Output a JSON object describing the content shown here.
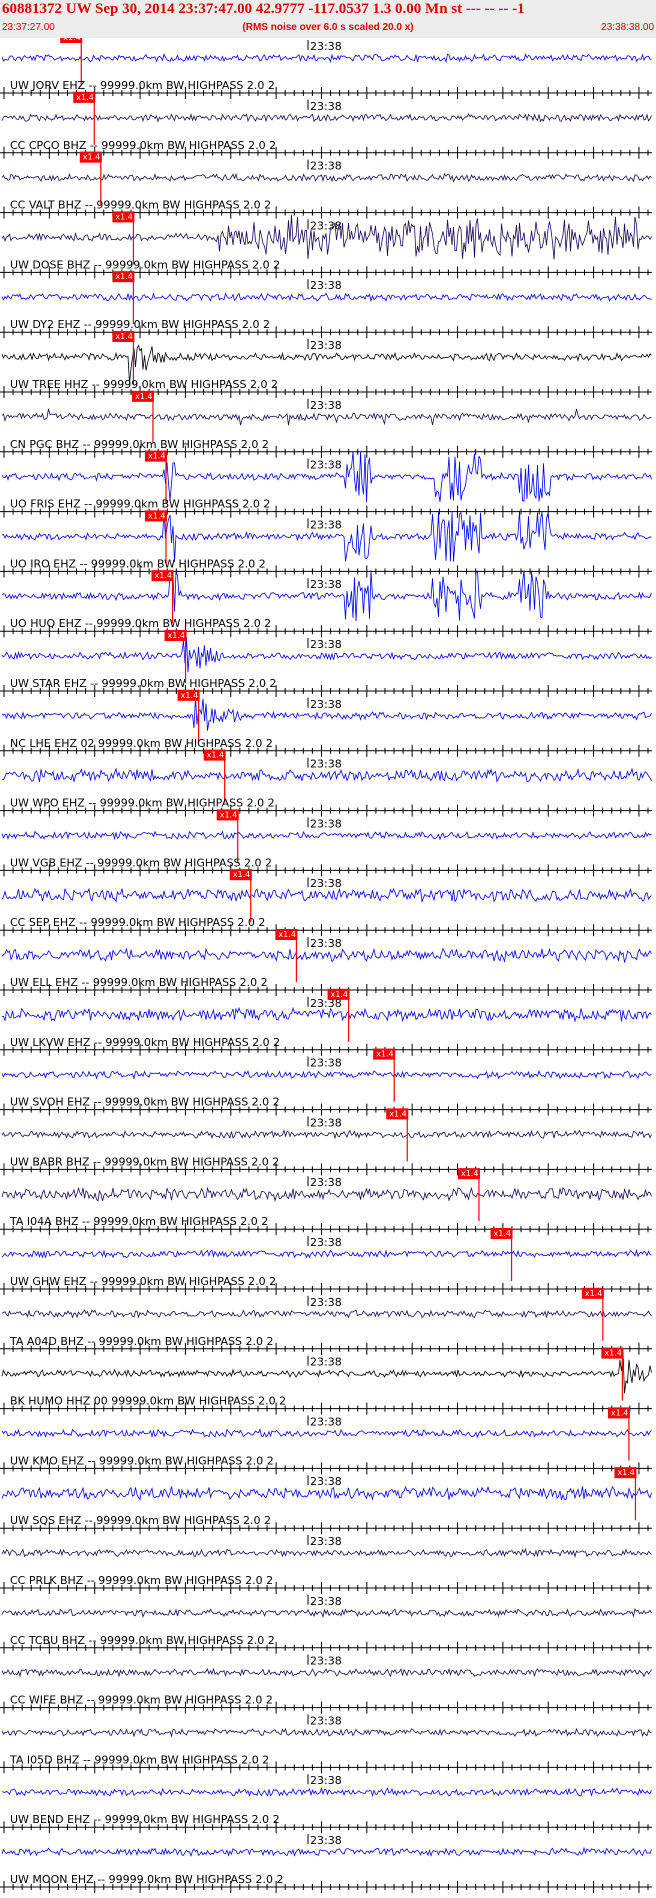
{
  "header": {
    "title": "60881372 UW Sep 30, 2014 23:37:47.00   42.9777 -117.0537  1.3 0.00 Mn st --- -- --   -1",
    "start_time": "23:37:27.00",
    "note": "(RMS noise over 6.0 s scaled 20.0 x)",
    "end_time": "23:38:38.00"
  },
  "colors": {
    "header_text": "#e00000",
    "header_bg": "#ededed",
    "pick": "#ff0000",
    "trace_blue": "#0000ff",
    "trace_navy": "#1a0a5a",
    "trace_black": "#000000"
  },
  "chart_data": {
    "type": "line",
    "title": "60881372 UW Sep 30, 2014 23:37:47.00   42.9777 -117.0537  1.3 0.00 Mn st --- -- --   -1",
    "x_range": [
      "23:37:27.00",
      "23:38:38.00"
    ],
    "time_mark": "23:38",
    "pick_label": "x1.4",
    "grid": false,
    "series": [
      {
        "label": "UW JORV EHZ -- 99999.0km BW  HIGHPASS  2.0  2",
        "color": "#0000ff",
        "pick": 0.12,
        "activity": "low"
      },
      {
        "label": "CC CPCO BHZ -- 99999.0km BW  HIGHPASS  2.0  2",
        "color": "#1a0a5a",
        "pick": 0.14,
        "activity": "low"
      },
      {
        "label": "CC VALT BHZ -- 99999.0km BW  HIGHPASS  2.0  2",
        "color": "#1a0a5a",
        "pick": 0.15,
        "activity": "low"
      },
      {
        "label": "UW DOSE BHZ -- 99999.0km BW  HIGHPASS  2.0  2",
        "color": "#1a0a5a",
        "pick": 0.2,
        "activity": "high"
      },
      {
        "label": "UW DY2 EHZ -- 99999.0km BW  HIGHPASS  2.0  2",
        "color": "#0000ff",
        "pick": 0.2,
        "activity": "low"
      },
      {
        "label": "UW TREE HHZ -- 99999.0km BW  HIGHPASS  2.0  2",
        "color": "#000000",
        "pick": 0.2,
        "activity": "event"
      },
      {
        "label": "CN PGC BHZ -- 99999.0km BW  HIGHPASS  2.0  2",
        "color": "#1a0a5a",
        "pick": 0.23,
        "activity": "spiky"
      },
      {
        "label": "UO FRIS EHZ -- 99999.0km BW  HIGHPASS  2.0  2",
        "color": "#0000ff",
        "pick": 0.25,
        "activity": "bursts"
      },
      {
        "label": "UO IRO EHZ -- 99999.0km BW  HIGHPASS  2.0  2",
        "color": "#0000ff",
        "pick": 0.25,
        "activity": "bursts"
      },
      {
        "label": "UO HUQ EHZ -- 99999.0km BW  HIGHPASS  2.0  2",
        "color": "#0000ff",
        "pick": 0.26,
        "activity": "bursts"
      },
      {
        "label": "UW STAR EHZ -- 99999.0km BW  HIGHPASS  2.0  2",
        "color": "#0000ff",
        "pick": 0.28,
        "activity": "event"
      },
      {
        "label": "NC LHE EHZ 02 99999.0km BW  HIGHPASS  2.0  2",
        "color": "#0000ff",
        "pick": 0.3,
        "activity": "event"
      },
      {
        "label": "UW WPO EHZ -- 99999.0km BW  HIGHPASS  2.0  2",
        "color": "#0000ff",
        "pick": 0.34,
        "activity": "medium"
      },
      {
        "label": "UW VGB EHZ -- 99999.0km BW  HIGHPASS  2.0  2",
        "color": "#0000ff",
        "pick": 0.36,
        "activity": "low"
      },
      {
        "label": "CC SEP EHZ -- 99999.0km BW  HIGHPASS  2.0  2",
        "color": "#0000ff",
        "pick": 0.38,
        "activity": "medium"
      },
      {
        "label": "UW ELL EHZ -- 99999.0km BW  HIGHPASS  2.0  2",
        "color": "#0000ff",
        "pick": 0.45,
        "activity": "medium"
      },
      {
        "label": "UW LKVW EHZ -- 99999.0km BW  HIGHPASS  2.0  2",
        "color": "#0000ff",
        "pick": 0.53,
        "activity": "medium"
      },
      {
        "label": "UW SVOH EHZ -- 99999.0km BW  HIGHPASS  2.0  2",
        "color": "#0000ff",
        "pick": 0.6,
        "activity": "low"
      },
      {
        "label": "UW BABR BHZ -- 99999.0km BW  HIGHPASS  2.0  2",
        "color": "#1a0a5a",
        "pick": 0.62,
        "activity": "low"
      },
      {
        "label": "TA I04A BHZ -- 99999.0km BW  HIGHPASS  2.0  2",
        "color": "#1a0a5a",
        "pick": 0.73,
        "activity": "medium"
      },
      {
        "label": "UW GHW EHZ -- 99999.0km BW  HIGHPASS  2.0  2",
        "color": "#0000ff",
        "pick": 0.78,
        "activity": "low"
      },
      {
        "label": "TA A04D BHZ -- 99999.0km BW  HIGHPASS  2.0  2",
        "color": "#1a0a5a",
        "pick": 0.92,
        "activity": "low"
      },
      {
        "label": "BK HUMO HHZ 00 99999.0km BW  HIGHPASS  2.0  2",
        "color": "#000000",
        "pick": 0.95,
        "activity": "event"
      },
      {
        "label": "UW KMO EHZ -- 99999.0km BW  HIGHPASS  2.0  2",
        "color": "#0000ff",
        "pick": 0.96,
        "activity": "low"
      },
      {
        "label": "UW SQS EHZ -- 99999.0km BW  HIGHPASS  2.0  2",
        "color": "#0000ff",
        "pick": 0.97,
        "activity": "medium"
      },
      {
        "label": "CC PRLK BHZ -- 99999.0km BW  HIGHPASS  2.0  2",
        "color": "#1a0a5a",
        "pick": null,
        "activity": "low"
      },
      {
        "label": "CC TCBU BHZ -- 99999.0km BW  HIGHPASS  2.0  2",
        "color": "#1a0a5a",
        "pick": null,
        "activity": "low"
      },
      {
        "label": "CC WIFE BHZ -- 99999.0km BW  HIGHPASS  2.0  2",
        "color": "#1a0a5a",
        "pick": null,
        "activity": "low"
      },
      {
        "label": "TA I05D BHZ -- 99999.0km BW  HIGHPASS  2.0  2",
        "color": "#1a0a5a",
        "pick": null,
        "activity": "low"
      },
      {
        "label": "UW BEND EHZ -- 99999.0km BW  HIGHPASS  2.0  2",
        "color": "#0000ff",
        "pick": null,
        "activity": "low"
      },
      {
        "label": "UW MOON EHZ -- 99999.0km BW  HIGHPASS  2.0  2",
        "color": "#0000ff",
        "pick": null,
        "activity": "low"
      }
    ]
  }
}
